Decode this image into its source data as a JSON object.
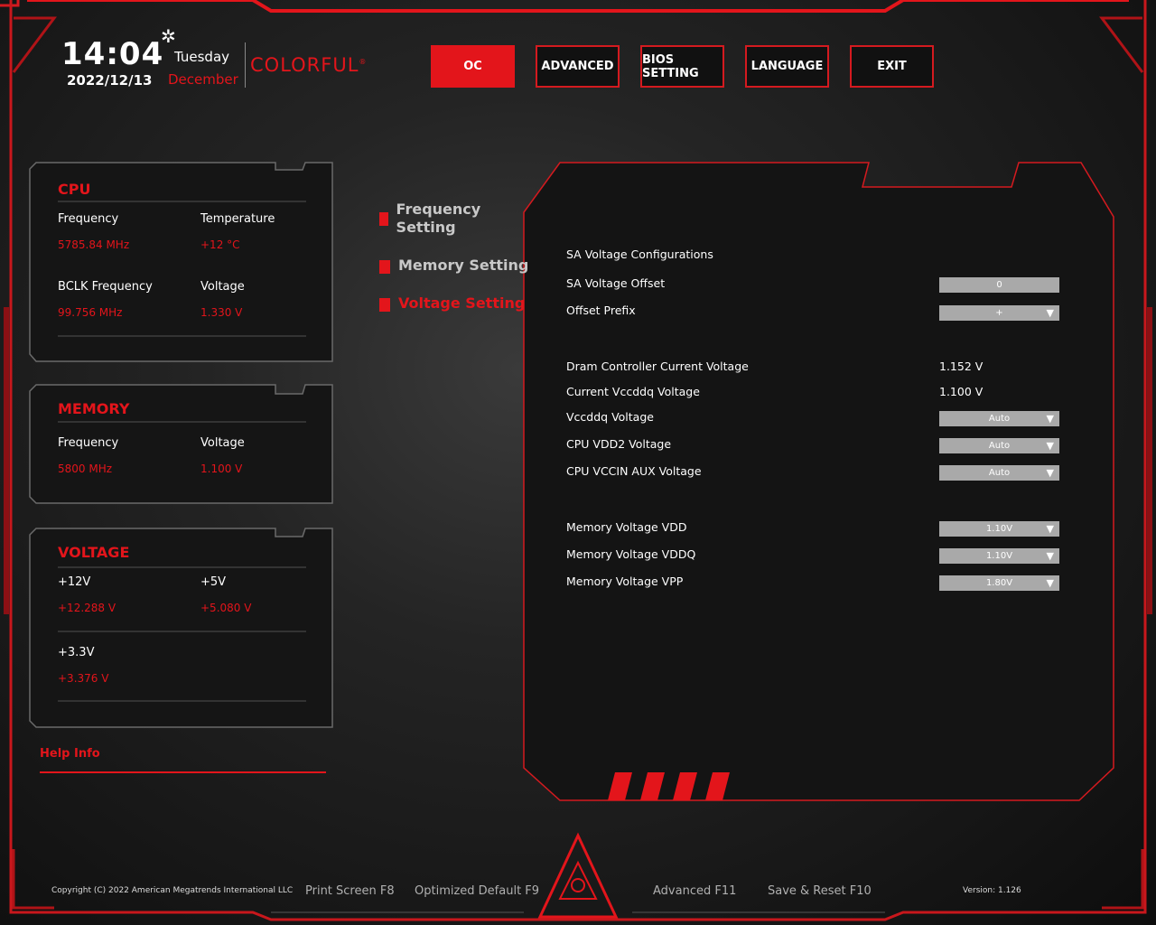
{
  "header": {
    "time": "14:04",
    "day": "Tuesday",
    "date": "2022/12/13",
    "month": "December",
    "brand": "COLORFUL",
    "brand_mark": "®",
    "tabs": [
      {
        "label": "OC",
        "active": true
      },
      {
        "label": "ADVANCED",
        "active": false
      },
      {
        "label": "BIOS SETTING",
        "active": false
      },
      {
        "label": "LANGUAGE",
        "active": false
      },
      {
        "label": "EXIT",
        "active": false
      }
    ]
  },
  "cpu": {
    "title": "CPU",
    "frequency_label": "Frequency",
    "frequency_value": "5785.84 MHz",
    "temperature_label": "Temperature",
    "temperature_value": "+12 °C",
    "bclk_label": "BCLK Frequency",
    "bclk_value": "99.756 MHz",
    "voltage_label": "Voltage",
    "voltage_value": "1.330 V"
  },
  "memory": {
    "title": "MEMORY",
    "frequency_label": "Frequency",
    "frequency_value": "5800 MHz",
    "voltage_label": "Voltage",
    "voltage_value": "1.100 V"
  },
  "voltage": {
    "title": "VOLTAGE",
    "v12_label": "+12V",
    "v12_value": "+12.288 V",
    "v5_label": "+5V",
    "v5_value": "+5.080 V",
    "v33_label": "+3.3V",
    "v33_value": "+3.376 V"
  },
  "help": {
    "label": "Help Info"
  },
  "menu": [
    {
      "label": "Frequency Setting",
      "active": false
    },
    {
      "label": "Memory Setting",
      "active": false
    },
    {
      "label": "Voltage Setting",
      "active": true
    }
  ],
  "settings": {
    "sa_header": "SA Voltage Configurations",
    "sa_offset_label": "SA Voltage Offset",
    "sa_offset_value": "0",
    "offset_prefix_label": "Offset Prefix",
    "offset_prefix_value": "+",
    "dram_ctrl_label": "Dram Controller Current Voltage",
    "dram_ctrl_value": "1.152 V",
    "cur_vccddq_label": "Current Vccddq Voltage",
    "cur_vccddq_value": "1.100 V",
    "vccddq_label": "Vccddq Voltage",
    "vccddq_value": "Auto",
    "vdd2_label": "CPU VDD2 Voltage",
    "vdd2_value": "Auto",
    "vccin_aux_label": "CPU VCCIN AUX Voltage",
    "vccin_aux_value": "Auto",
    "mem_vdd_label": "Memory Voltage VDD",
    "mem_vdd_value": "1.10V",
    "mem_vddq_label": "Memory Voltage VDDQ",
    "mem_vddq_value": "1.10V",
    "mem_vpp_label": "Memory Voltage VPP",
    "mem_vpp_value": "1.80V",
    "dropdown_arrow": "▼"
  },
  "footer": {
    "copyright": "Copyright (C) 2022 American Megatrends International LLC",
    "print_screen": "Print Screen F8",
    "optimized_default": "Optimized Default F9",
    "advanced": "Advanced F11",
    "save_reset": "Save & Reset F10",
    "version": "Version: 1.126"
  },
  "colors": {
    "accent": "#e3151b",
    "control_bg": "#a9a9a9",
    "panel_bg": "#141414"
  }
}
